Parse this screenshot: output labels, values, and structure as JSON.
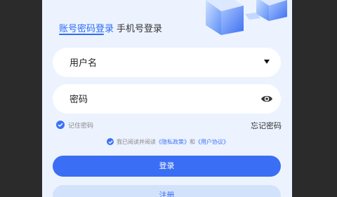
{
  "tabs": [
    {
      "label": "账号密码登录",
      "active": true
    },
    {
      "label": "手机号登录",
      "active": false
    }
  ],
  "username": {
    "placeholder": "用户名",
    "icon": "triangle-down-icon"
  },
  "password": {
    "placeholder": "密码",
    "icon": "eye-icon"
  },
  "remember": {
    "label": "记住密码",
    "checked": true
  },
  "forgot_password": "忘记密码",
  "agreement": {
    "checked": true,
    "prefix": "我已阅读并阅读",
    "privacy_link": "《隐私政策》",
    "connector": "和",
    "user_link": "《用户协议》"
  },
  "login_button": "登录",
  "register_button": "注册",
  "colors": {
    "accent": "#3a6ef5",
    "background": "#ecf3ff",
    "register_bg": "#d3e2fb"
  }
}
